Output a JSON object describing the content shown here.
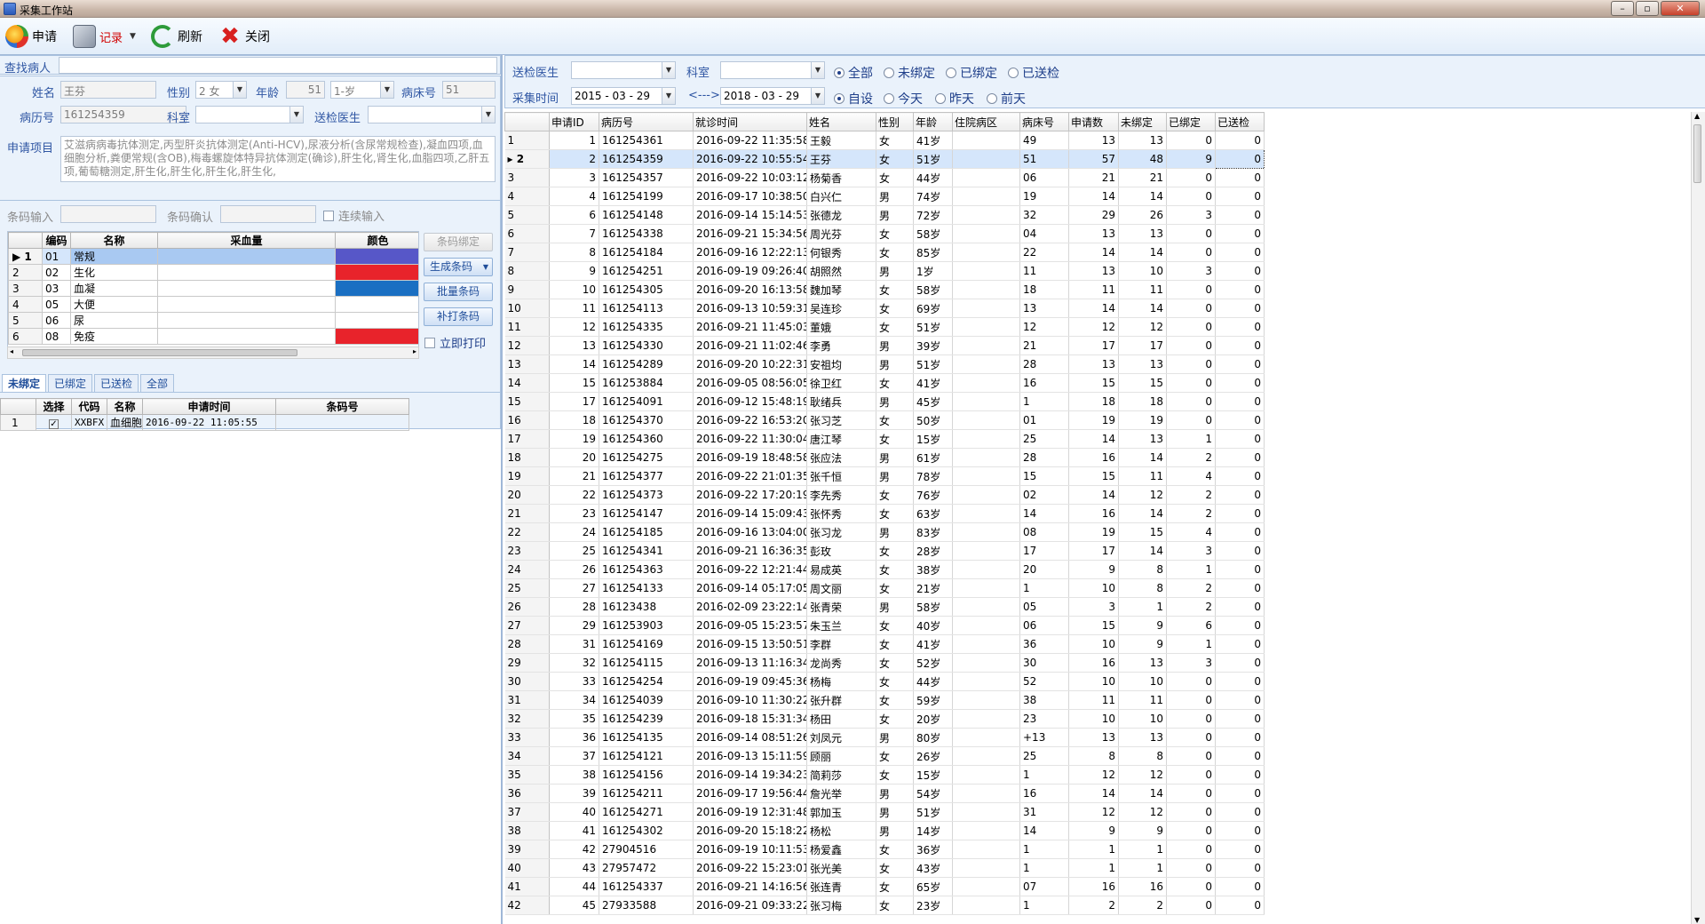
{
  "window": {
    "title": "采集工作站"
  },
  "toolbar": {
    "apply": "申请",
    "record": "记录",
    "refresh": "刷新",
    "close": "关闭"
  },
  "left": {
    "find_label": "查找病人",
    "find_value": "",
    "name_label": "姓名",
    "name_value": "王芬",
    "sex_label": "性别",
    "sex_value": "2 女",
    "age_label": "年龄",
    "age_value": "51",
    "age_unit": "1-岁",
    "bed_label": "病床号",
    "bed_value": "51",
    "record_label": "病历号",
    "record_value": "161254359",
    "dept_label": "科室",
    "dept_value": "",
    "doctor_label": "送检医生",
    "doctor_value": "",
    "items_label": "申请项目",
    "items_value": "艾滋病病毒抗体测定,丙型肝炎抗体测定(Anti-HCV),尿液分析(含尿常规检查),凝血四项,血细胞分析,粪便常规(含OB),梅毒螺旋体特异抗体测定(确诊),肝生化,肾生化,血脂四项,乙肝五项,葡萄糖测定,肝生化,肝生化,肝生化,肝生化,",
    "barcode_label": "条码输入",
    "barcode_confirm_label": "条码确认",
    "continuous_label": "连续输入",
    "tube_headers": [
      "",
      "编码",
      "名称",
      "采血量",
      "颜色"
    ],
    "tubes": [
      {
        "row": "1",
        "code": "01",
        "name": "常规",
        "amount": "",
        "color": "#5757c8"
      },
      {
        "row": "2",
        "code": "02",
        "name": "生化",
        "amount": "",
        "color": "#e8232b"
      },
      {
        "row": "3",
        "code": "03",
        "name": "血凝",
        "amount": "",
        "color": "#1a6fc2"
      },
      {
        "row": "4",
        "code": "05",
        "name": "大便",
        "amount": "",
        "color": "#ffffff"
      },
      {
        "row": "5",
        "code": "06",
        "name": "尿",
        "amount": "",
        "color": "#ffffff"
      },
      {
        "row": "6",
        "code": "08",
        "name": "免疫",
        "amount": "",
        "color": "#e8232b"
      }
    ],
    "btn_bind": "条码绑定",
    "btn_generate": "生成条码",
    "btn_batch": "批量条码",
    "btn_reprint": "补打条码",
    "print_now": "立即打印",
    "tabs": [
      "未绑定",
      "已绑定",
      "已送检",
      "全部"
    ],
    "bottom_headers": [
      "",
      "选择",
      "代码",
      "名称",
      "申请时间",
      "条码号"
    ],
    "bottom_rows": [
      {
        "row": "1",
        "code": "XXBFX",
        "name": "血细胞",
        "time": "2016-09-22 11:05:55",
        "barcode": ""
      }
    ]
  },
  "right": {
    "doctor_label": "送检医生",
    "dept_label": "科室",
    "filter_all": "全部",
    "filter_unbound": "未绑定",
    "filter_bound": "已绑定",
    "filter_sent": "已送检",
    "time_label": "采集时间",
    "date_from": "2015 - 03 - 29",
    "arrow": "<--->",
    "date_to": "2018 - 03 - 29",
    "range_custom": "自设",
    "range_today": "今天",
    "range_yesterday": "昨天",
    "range_before": "前天",
    "headers": [
      "",
      "申请ID",
      "病历号",
      "就诊时间",
      "姓名",
      "性别",
      "年龄",
      "住院病区",
      "病床号",
      "申请数",
      "未绑定",
      "已绑定",
      "已送检"
    ],
    "rows": [
      [
        "1",
        "1",
        "161254361",
        "2016-09-22 11:35:58",
        "王毅",
        "女",
        "41岁",
        "",
        "49",
        "13",
        "13",
        "0",
        "0"
      ],
      [
        "2",
        "2",
        "161254359",
        "2016-09-22 10:55:54",
        "王芬",
        "女",
        "51岁",
        "",
        "51",
        "57",
        "48",
        "9",
        "0"
      ],
      [
        "3",
        "3",
        "161254357",
        "2016-09-22 10:03:12",
        "杨菊香",
        "女",
        "44岁",
        "",
        "06",
        "21",
        "21",
        "0",
        "0"
      ],
      [
        "4",
        "4",
        "161254199",
        "2016-09-17 10:38:50",
        "白兴仁",
        "男",
        "74岁",
        "",
        "19",
        "14",
        "14",
        "0",
        "0"
      ],
      [
        "5",
        "6",
        "161254148",
        "2016-09-14 15:14:53",
        "张德龙",
        "男",
        "72岁",
        "",
        "32",
        "29",
        "26",
        "3",
        "0"
      ],
      [
        "6",
        "7",
        "161254338",
        "2016-09-21 15:34:56",
        "周光芬",
        "女",
        "58岁",
        "",
        "04",
        "13",
        "13",
        "0",
        "0"
      ],
      [
        "7",
        "8",
        "161254184",
        "2016-09-16 12:22:13",
        "何银秀",
        "女",
        "85岁",
        "",
        "22",
        "14",
        "14",
        "0",
        "0"
      ],
      [
        "8",
        "9",
        "161254251",
        "2016-09-19 09:26:40",
        "胡照然",
        "男",
        "1岁",
        "",
        "11",
        "13",
        "10",
        "3",
        "0"
      ],
      [
        "9",
        "10",
        "161254305",
        "2016-09-20 16:13:58",
        "魏加琴",
        "女",
        "58岁",
        "",
        "18",
        "11",
        "11",
        "0",
        "0"
      ],
      [
        "10",
        "11",
        "161254113",
        "2016-09-13 10:59:31",
        "吴连珍",
        "女",
        "69岁",
        "",
        "13",
        "14",
        "14",
        "0",
        "0"
      ],
      [
        "11",
        "12",
        "161254335",
        "2016-09-21 11:45:03",
        "董娥",
        "女",
        "51岁",
        "",
        "12",
        "12",
        "12",
        "0",
        "0"
      ],
      [
        "12",
        "13",
        "161254330",
        "2016-09-21 11:02:46",
        "李勇",
        "男",
        "39岁",
        "",
        "21",
        "17",
        "17",
        "0",
        "0"
      ],
      [
        "13",
        "14",
        "161254289",
        "2016-09-20 10:22:31",
        "安祖均",
        "男",
        "51岁",
        "",
        "28",
        "13",
        "13",
        "0",
        "0"
      ],
      [
        "14",
        "15",
        "161253884",
        "2016-09-05 08:56:05",
        "徐卫红",
        "女",
        "41岁",
        "",
        "16",
        "15",
        "15",
        "0",
        "0"
      ],
      [
        "15",
        "17",
        "161254091",
        "2016-09-12 15:48:19",
        "耿绪兵",
        "男",
        "45岁",
        "",
        "1",
        "18",
        "18",
        "0",
        "0"
      ],
      [
        "16",
        "18",
        "161254370",
        "2016-09-22 16:53:20",
        "张习芝",
        "女",
        "50岁",
        "",
        "01",
        "19",
        "19",
        "0",
        "0"
      ],
      [
        "17",
        "19",
        "161254360",
        "2016-09-22 11:30:04",
        "唐江琴",
        "女",
        "15岁",
        "",
        "25",
        "14",
        "13",
        "1",
        "0"
      ],
      [
        "18",
        "20",
        "161254275",
        "2016-09-19 18:48:58",
        "张应法",
        "男",
        "61岁",
        "",
        "28",
        "16",
        "14",
        "2",
        "0"
      ],
      [
        "19",
        "21",
        "161254377",
        "2016-09-22 21:01:35",
        "张千恒",
        "男",
        "78岁",
        "",
        "15",
        "15",
        "11",
        "4",
        "0"
      ],
      [
        "20",
        "22",
        "161254373",
        "2016-09-22 17:20:19",
        "李先秀",
        "女",
        "76岁",
        "",
        "02",
        "14",
        "12",
        "2",
        "0"
      ],
      [
        "21",
        "23",
        "161254147",
        "2016-09-14 15:09:43",
        "张怀秀",
        "女",
        "63岁",
        "",
        "14",
        "16",
        "14",
        "2",
        "0"
      ],
      [
        "22",
        "24",
        "161254185",
        "2016-09-16 13:04:00",
        "张习龙",
        "男",
        "83岁",
        "",
        "08",
        "19",
        "15",
        "4",
        "0"
      ],
      [
        "23",
        "25",
        "161254341",
        "2016-09-21 16:36:35",
        "彭玫",
        "女",
        "28岁",
        "",
        "17",
        "17",
        "14",
        "3",
        "0"
      ],
      [
        "24",
        "26",
        "161254363",
        "2016-09-22 12:21:44",
        "易成英",
        "女",
        "38岁",
        "",
        "20",
        "9",
        "8",
        "1",
        "0"
      ],
      [
        "25",
        "27",
        "161254133",
        "2016-09-14 05:17:05",
        "周文丽",
        "女",
        "21岁",
        "",
        "1",
        "10",
        "8",
        "2",
        "0"
      ],
      [
        "26",
        "28",
        "16123438",
        "2016-02-09 23:22:14",
        "张青荣",
        "男",
        "58岁",
        "",
        "05",
        "3",
        "1",
        "2",
        "0"
      ],
      [
        "27",
        "29",
        "161253903",
        "2016-09-05 15:23:57",
        "朱玉兰",
        "女",
        "40岁",
        "",
        "06",
        "15",
        "9",
        "6",
        "0"
      ],
      [
        "28",
        "31",
        "161254169",
        "2016-09-15 13:50:51",
        "李群",
        "女",
        "41岁",
        "",
        "36",
        "10",
        "9",
        "1",
        "0"
      ],
      [
        "29",
        "32",
        "161254115",
        "2016-09-13 11:16:34",
        "龙尚秀",
        "女",
        "52岁",
        "",
        "30",
        "16",
        "13",
        "3",
        "0"
      ],
      [
        "30",
        "33",
        "161254254",
        "2016-09-19 09:45:36",
        "杨梅",
        "女",
        "44岁",
        "",
        "52",
        "10",
        "10",
        "0",
        "0"
      ],
      [
        "31",
        "34",
        "161254039",
        "2016-09-10 11:30:22",
        "张升群",
        "女",
        "59岁",
        "",
        "38",
        "11",
        "11",
        "0",
        "0"
      ],
      [
        "32",
        "35",
        "161254239",
        "2016-09-18 15:31:34",
        "杨田",
        "女",
        "20岁",
        "",
        "23",
        "10",
        "10",
        "0",
        "0"
      ],
      [
        "33",
        "36",
        "161254135",
        "2016-09-14 08:51:26",
        "刘凤元",
        "男",
        "80岁",
        "",
        "+13",
        "13",
        "13",
        "0",
        "0"
      ],
      [
        "34",
        "37",
        "161254121",
        "2016-09-13 15:11:59",
        "顾丽",
        "女",
        "26岁",
        "",
        "25",
        "8",
        "8",
        "0",
        "0"
      ],
      [
        "35",
        "38",
        "161254156",
        "2016-09-14 19:34:23",
        "简莉莎",
        "女",
        "15岁",
        "",
        "1",
        "12",
        "12",
        "0",
        "0"
      ],
      [
        "36",
        "39",
        "161254211",
        "2016-09-17 19:56:44",
        "詹光举",
        "男",
        "54岁",
        "",
        "16",
        "14",
        "14",
        "0",
        "0"
      ],
      [
        "37",
        "40",
        "161254271",
        "2016-09-19 12:31:48",
        "郭加玉",
        "男",
        "51岁",
        "",
        "31",
        "12",
        "12",
        "0",
        "0"
      ],
      [
        "38",
        "41",
        "161254302",
        "2016-09-20 15:18:22",
        "杨松",
        "男",
        "14岁",
        "",
        "14",
        "9",
        "9",
        "0",
        "0"
      ],
      [
        "39",
        "42",
        "27904516",
        "2016-09-19 10:11:53",
        "杨爱鑫",
        "女",
        "36岁",
        "",
        "1",
        "1",
        "1",
        "0",
        "0"
      ],
      [
        "40",
        "43",
        "27957472",
        "2016-09-22 15:23:01",
        "张光美",
        "女",
        "43岁",
        "",
        "1",
        "1",
        "1",
        "0",
        "0"
      ],
      [
        "41",
        "44",
        "161254337",
        "2016-09-21 14:16:56",
        "张连青",
        "女",
        "65岁",
        "",
        "07",
        "16",
        "16",
        "0",
        "0"
      ],
      [
        "42",
        "45",
        "27933588",
        "2016-09-21 09:33:22",
        "张习梅",
        "女",
        "23岁",
        "",
        "1",
        "2",
        "2",
        "0",
        "0"
      ]
    ]
  }
}
